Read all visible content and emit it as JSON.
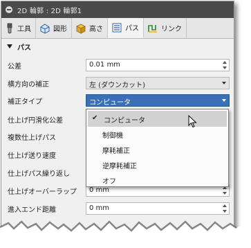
{
  "window": {
    "title": "2D 輪郭 : 2D 輪郭1"
  },
  "tabs": [
    {
      "label": "工具",
      "icon": "tool-icon"
    },
    {
      "label": "図形",
      "icon": "geometry-icon"
    },
    {
      "label": "高さ",
      "icon": "heights-icon"
    },
    {
      "label": "パス",
      "icon": "passes-icon"
    },
    {
      "label": "リンク",
      "icon": "linking-icon"
    }
  ],
  "section": {
    "label": "パス"
  },
  "rows": [
    {
      "label": "公差",
      "value": "0.01 mm"
    },
    {
      "label": "横方向の補正",
      "value": "左 (ダウンカット)"
    },
    {
      "label": "補正タイプ",
      "value": "コンピュータ"
    },
    {
      "label": "仕上げ円滑化公差",
      "value": ""
    },
    {
      "label": "複数仕上げパス",
      "value": ""
    },
    {
      "label": "仕上げ送り速度",
      "value": ""
    },
    {
      "label": "仕上げパス繰り返し",
      "value": ""
    },
    {
      "label": "仕上げオーバーラップ",
      "value": "0 mm"
    },
    {
      "label": "進入エンド距離",
      "value": "0 mm"
    }
  ],
  "popup": {
    "options": [
      "コンピュータ",
      "制御機",
      "摩耗補正",
      "逆摩耗補正",
      "オフ"
    ],
    "selected_index": 0
  },
  "colors": {
    "titlebar": "#4b4b4b",
    "accent": "#3b6fb6"
  }
}
